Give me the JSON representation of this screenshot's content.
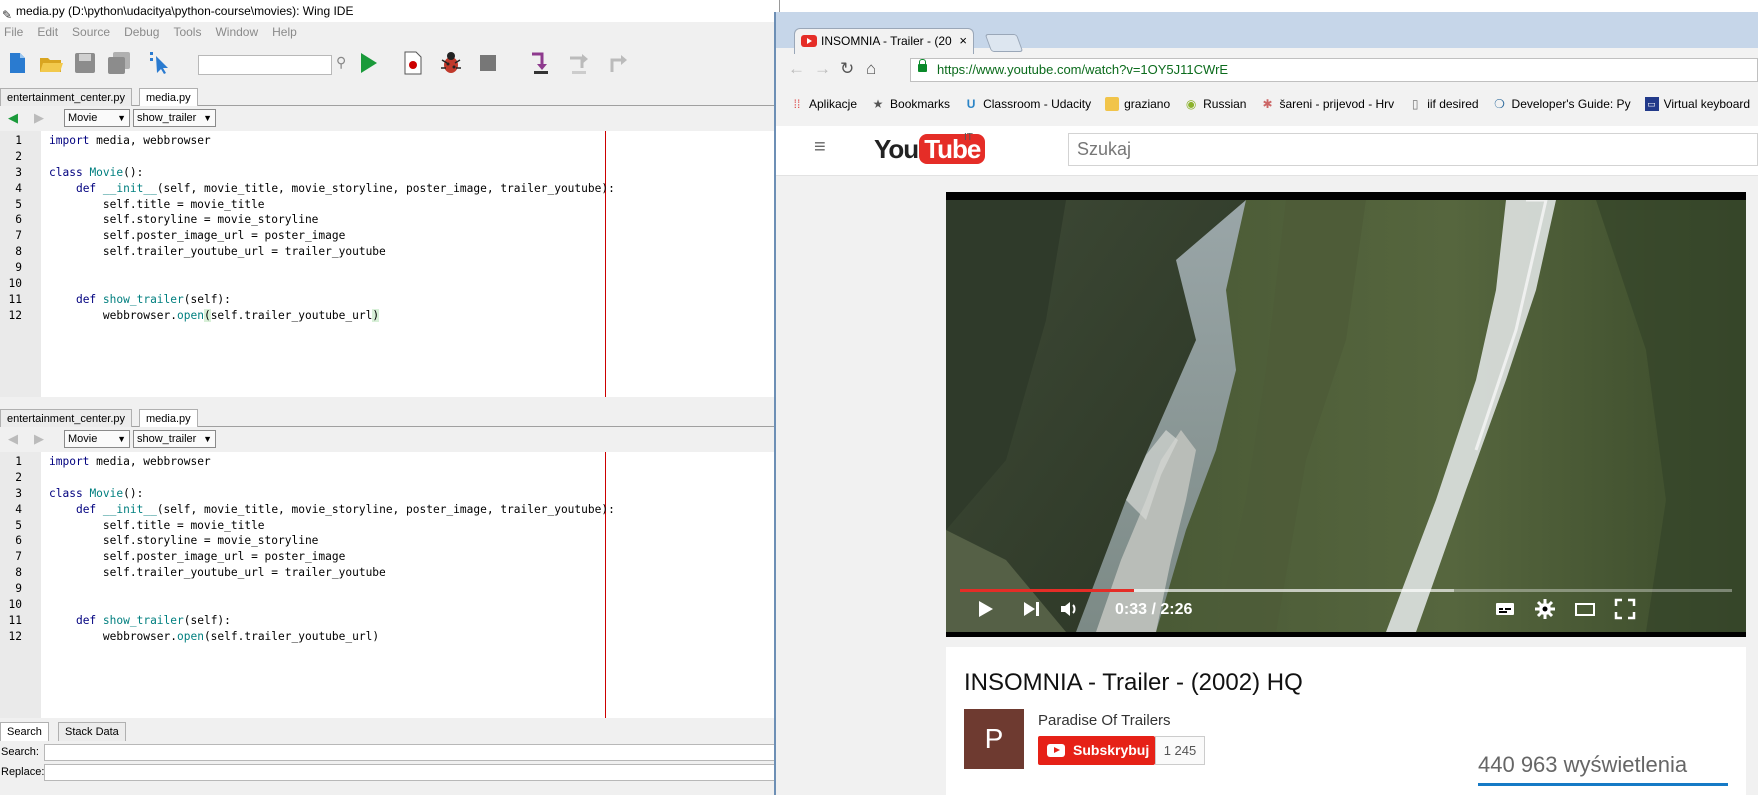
{
  "wing": {
    "title": "media.py (D:\\python\\udacitya\\python-course\\movies): Wing IDE",
    "menu": [
      "File",
      "Edit",
      "Source",
      "Debug",
      "Tools",
      "Window",
      "Help"
    ],
    "toolbar_icons": [
      "new-file-icon",
      "open-folder-icon",
      "save-icon",
      "save-all-icon",
      "pointer-search-icon",
      "search-field",
      "run-icon",
      "record-icon",
      "debug-bug-icon",
      "stop-icon",
      "step-into-icon",
      "step-over-icon",
      "step-out-icon"
    ],
    "pane1": {
      "tabs": [
        "entertainment_center.py",
        "media.py"
      ],
      "active_tab": 1,
      "class_select": "Movie",
      "method_select": "show_trailer"
    },
    "pane2": {
      "tabs": [
        "entertainment_center.py",
        "media.py"
      ],
      "active_tab": 1,
      "class_select": "Movie",
      "method_select": "show_trailer"
    },
    "code_lines": [
      "import media, webbrowser",
      "",
      "class Movie():",
      "    def __init__(self, movie_title, movie_storyline, poster_image, trailer_youtube):",
      "        self.title = movie_title",
      "        self.storyline = movie_storyline",
      "        self.poster_image_url = poster_image",
      "        self.trailer_youtube_url = trailer_youtube",
      "",
      "",
      "    def show_trailer(self):",
      "        webbrowser.open(self.trailer_youtube_url)"
    ],
    "line_numbers": [
      "1",
      "2",
      "3",
      "4",
      "5",
      "6",
      "7",
      "8",
      "9",
      "10",
      "11",
      "12"
    ],
    "bottom_tabs": [
      "Search",
      "Stack Data"
    ],
    "search_label": "Search:",
    "replace_label": "Replace:"
  },
  "chrome": {
    "tab_title": "INSOMNIA - Trailer - (20",
    "tab_close": "×",
    "url": "https://www.youtube.com/watch?v=1OY5J11CWrE",
    "bookmarks": [
      {
        "label": "Aplikacje",
        "icon": "apps-grid-icon"
      },
      {
        "label": "Bookmarks",
        "icon": "star-icon"
      },
      {
        "label": "Classroom - Udacity",
        "icon": "udacity-icon"
      },
      {
        "label": "graziano",
        "icon": "folder-icon"
      },
      {
        "label": "Russian",
        "icon": "circle-site-icon"
      },
      {
        "label": "šareni - prijevod - Hrv",
        "icon": "translate-site-icon"
      },
      {
        "label": "iif desired",
        "icon": "page-icon"
      },
      {
        "label": "Developer's Guide: Py",
        "icon": "python-site-icon"
      },
      {
        "label": "Virtual keyboard",
        "icon": "keyboard-site-icon"
      }
    ]
  },
  "youtube": {
    "logo_you": "You",
    "logo_tube": "Tube",
    "region": "IT",
    "search_placeholder": "Szukaj",
    "player": {
      "time": "0:33 / 2:26",
      "played_fraction": 0.226,
      "loaded_fraction": 0.64
    },
    "video_title": "INSOMNIA - Trailer - (2002) HQ",
    "channel": "Paradise Of Trailers",
    "avatar_letter": "P",
    "subscribe_label": "Subskrybuj",
    "subscriber_count": "1 245",
    "views": "440 963 wyświetlenia"
  }
}
